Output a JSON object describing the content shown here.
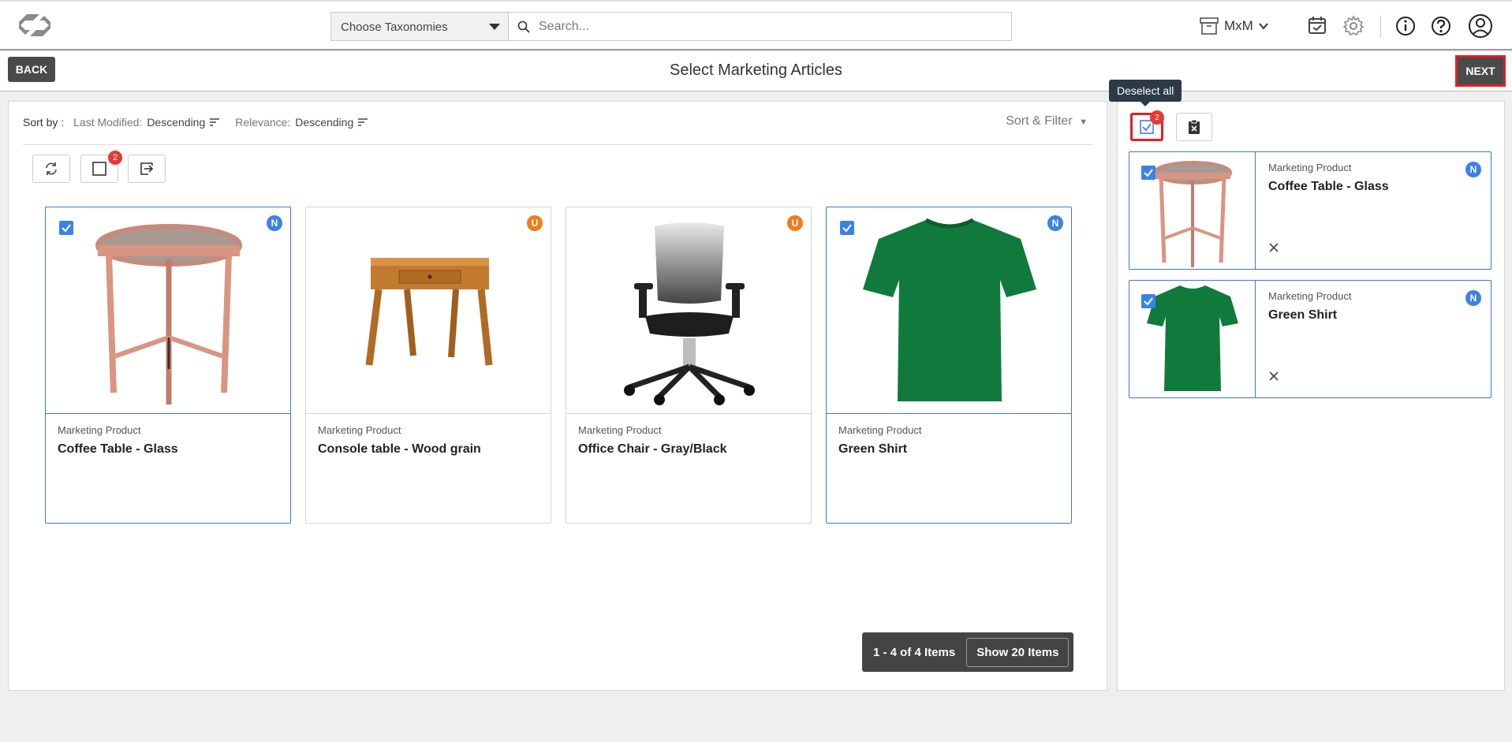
{
  "topbar": {
    "taxonomy_select": "Choose Taxonomies",
    "search_placeholder": "Search...",
    "workspace": "MxM"
  },
  "subbar": {
    "back_label": "BACK",
    "title": "Select Marketing Articles",
    "next_label": "NEXT"
  },
  "sort": {
    "label": "Sort by :",
    "fields": [
      {
        "name": "Last Modified:",
        "value": "Descending"
      },
      {
        "name": "Relevance:",
        "value": "Descending"
      }
    ],
    "filter_label": "Sort & Filter"
  },
  "toolbar": {
    "selected_badge": "2"
  },
  "cards": [
    {
      "type": "Marketing Product",
      "name": "Coffee Table - Glass",
      "status": "N",
      "selected": true,
      "icon": "coffee-table"
    },
    {
      "type": "Marketing Product",
      "name": "Console table - Wood grain",
      "status": "U",
      "selected": false,
      "icon": "console-table"
    },
    {
      "type": "Marketing Product",
      "name": "Office Chair - Gray/Black",
      "status": "U",
      "selected": false,
      "icon": "office-chair"
    },
    {
      "type": "Marketing Product",
      "name": "Green Shirt",
      "status": "N",
      "selected": true,
      "icon": "green-shirt"
    }
  ],
  "pager": {
    "count": "1 - 4 of 4 Items",
    "show": "Show 20 Items"
  },
  "right_panel": {
    "tooltip": "Deselect all",
    "selected": [
      {
        "type": "Marketing Product",
        "name": "Coffee Table - Glass",
        "status": "N"
      },
      {
        "type": "Marketing Product",
        "name": "Green Shirt",
        "status": "N"
      }
    ]
  },
  "colors": {
    "accent": "#3b82e6",
    "new_status": "#3b82e6",
    "updated_status": "#ef7d1a",
    "highlight": "#e02020"
  }
}
